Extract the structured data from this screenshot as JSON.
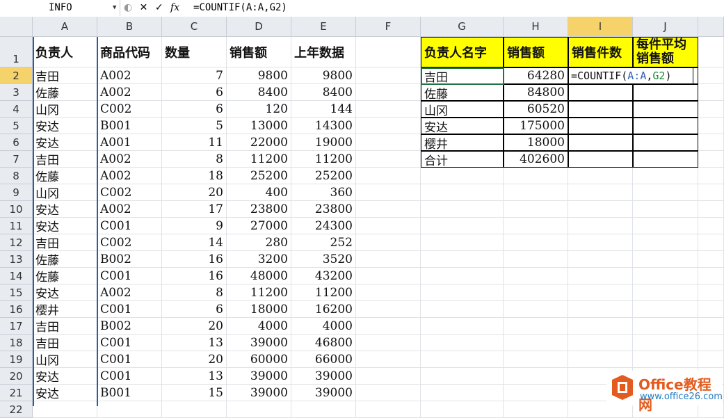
{
  "formula_bar": {
    "name_box": "INFO",
    "cancel_glyph": "✕",
    "enter_glyph": "✓",
    "fx_glyph": "fx",
    "formula": "=COUNTIF(A:A,G2)"
  },
  "columns": [
    "A",
    "B",
    "C",
    "D",
    "E",
    "F",
    "G",
    "H",
    "I",
    "J"
  ],
  "rows": [
    "1",
    "2",
    "3",
    "4",
    "5",
    "6",
    "7",
    "8",
    "9",
    "10",
    "11",
    "12",
    "13",
    "14",
    "15",
    "16",
    "17",
    "18",
    "19",
    "20",
    "21",
    "22"
  ],
  "headers": {
    "a": "负责人",
    "b": "商品代码",
    "c": "数量",
    "d": "销售额",
    "e": "上年数据"
  },
  "data": [
    [
      "吉田",
      "A002",
      "7",
      "9800",
      "9800"
    ],
    [
      "佐藤",
      "A002",
      "6",
      "8400",
      "8400"
    ],
    [
      "山冈",
      "C002",
      "6",
      "120",
      "144"
    ],
    [
      "安达",
      "B001",
      "5",
      "13000",
      "14300"
    ],
    [
      "安达",
      "A001",
      "11",
      "22000",
      "19000"
    ],
    [
      "吉田",
      "A002",
      "8",
      "11200",
      "11200"
    ],
    [
      "佐藤",
      "A002",
      "18",
      "25200",
      "25200"
    ],
    [
      "山冈",
      "C002",
      "20",
      "400",
      "360"
    ],
    [
      "安达",
      "A002",
      "17",
      "23800",
      "23800"
    ],
    [
      "安达",
      "C001",
      "9",
      "27000",
      "24300"
    ],
    [
      "吉田",
      "C002",
      "14",
      "280",
      "252"
    ],
    [
      "佐藤",
      "B002",
      "16",
      "3200",
      "3520"
    ],
    [
      "佐藤",
      "C001",
      "16",
      "48000",
      "43200"
    ],
    [
      "安达",
      "A002",
      "8",
      "11200",
      "11200"
    ],
    [
      "樱井",
      "C001",
      "6",
      "18000",
      "16200"
    ],
    [
      "吉田",
      "B002",
      "20",
      "4000",
      "4000"
    ],
    [
      "吉田",
      "C001",
      "13",
      "39000",
      "46800"
    ],
    [
      "山冈",
      "C001",
      "20",
      "60000",
      "66000"
    ],
    [
      "安达",
      "C001",
      "13",
      "39000",
      "39000"
    ],
    [
      "安达",
      "B001",
      "15",
      "39000",
      "39000"
    ]
  ],
  "summary_headers": {
    "g": "负责人名字",
    "h": "销售额",
    "i": "销售件数",
    "j1": "每件平均",
    "j2": "销售额"
  },
  "summary": [
    [
      "吉田",
      "64280"
    ],
    [
      "佐藤",
      "84800"
    ],
    [
      "山冈",
      "60520"
    ],
    [
      "安达",
      "175000"
    ],
    [
      "樱井",
      "18000"
    ],
    [
      "合计",
      "402600"
    ]
  ],
  "editing_formula": {
    "prefix": "=COUNTIF(",
    "ref1": "A:A",
    "comma": ",",
    "ref2": "G2",
    "suffix": ")"
  },
  "colors": {
    "ref1": "#2e5fb5",
    "ref2": "#1f8a3a",
    "header_yellow": "#ffff00"
  },
  "watermark": {
    "title": "Office教程网",
    "url": "www.office26.com"
  }
}
